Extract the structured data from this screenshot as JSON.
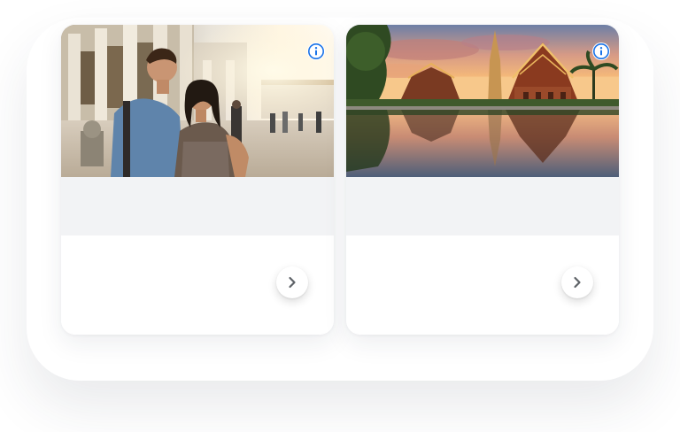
{
  "cards": [
    {
      "image": "couple-at-temple-photo",
      "info_icon": "info-icon",
      "next_icon": "chevron-right-icon"
    },
    {
      "image": "temple-sunset-reflection-photo",
      "info_icon": "info-icon",
      "next_icon": "chevron-right-icon"
    }
  ],
  "colors": {
    "info_accent": "#1a73e8",
    "chevron": "#5f6368",
    "band": "#f2f3f5"
  }
}
